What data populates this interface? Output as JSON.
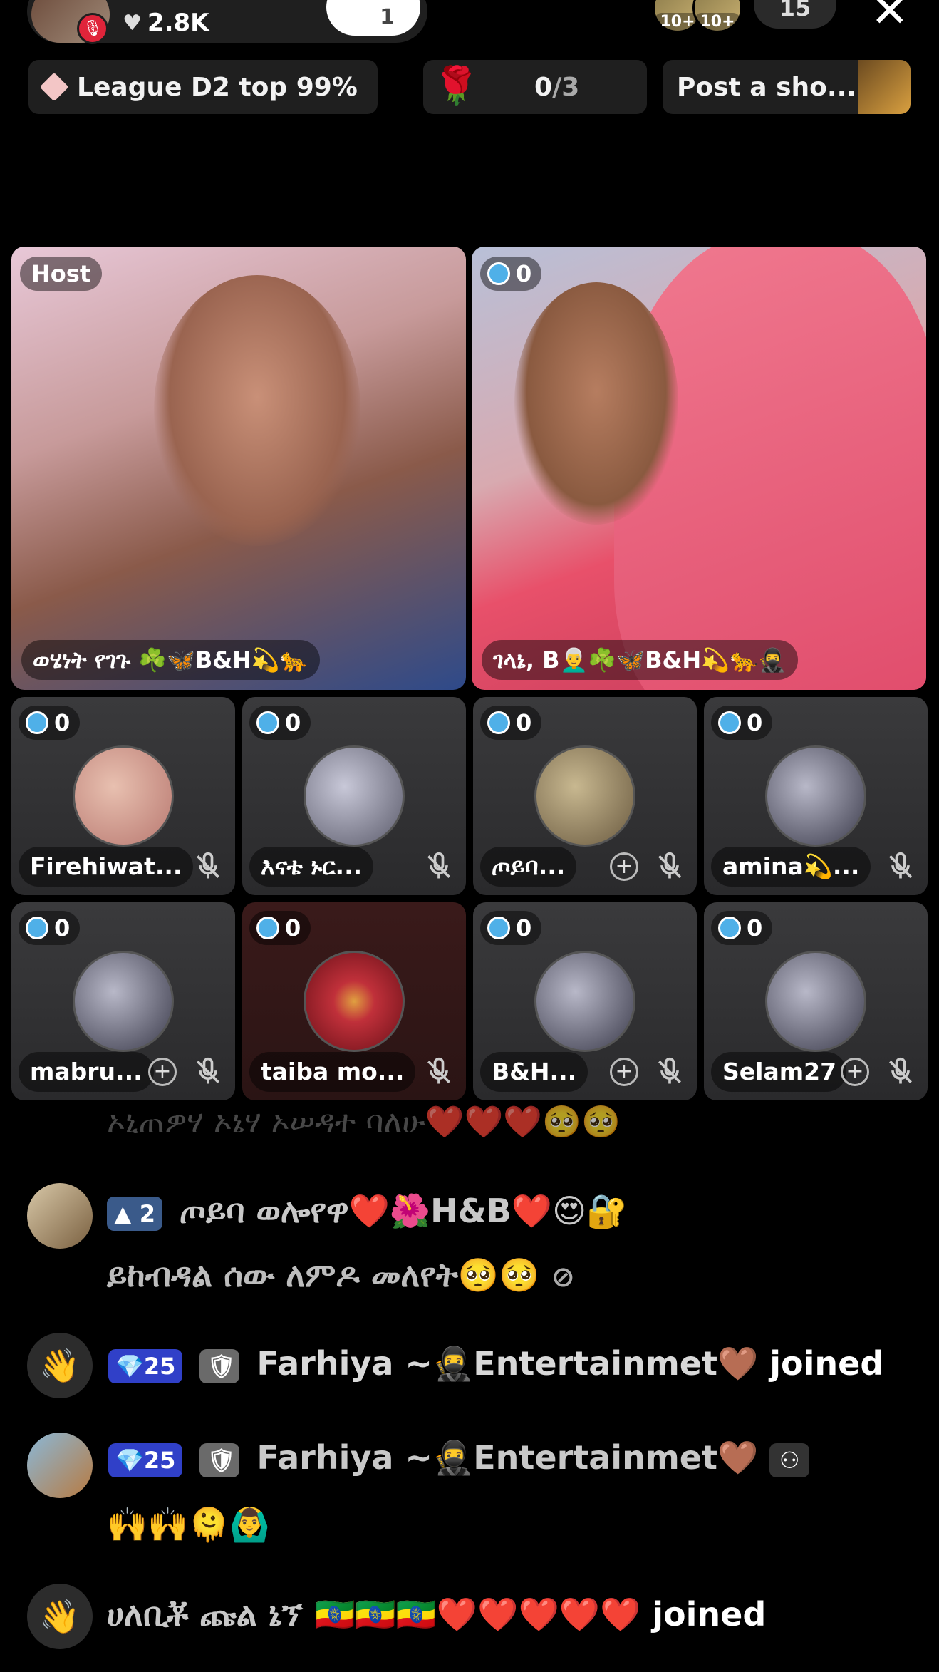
{
  "header": {
    "likes": "2.8K",
    "follow_count": "1",
    "viewer_tags": [
      "10+",
      "10+"
    ],
    "viewer_count": "15",
    "close_icon": "close-icon"
  },
  "chips": {
    "league": "League D2 top 99%",
    "rose_progress": "0",
    "rose_total": "/3",
    "post": "Post a sho..."
  },
  "host_tile": {
    "badge": "Host",
    "name": "ወሄነት የገጉ ☘️🦋B&H💫🐆"
  },
  "guest_tile": {
    "count": "0",
    "name": "ገላኔ, B👨‍🦳☘️🦋B&H💫🐆🥷"
  },
  "seats": [
    {
      "count": "0",
      "name": "Firehiwat...",
      "plus": false,
      "avatar_color": "#b87870"
    },
    {
      "count": "0",
      "name": "እናቴ ኑር...",
      "plus": false,
      "avatar_color": "#7a7a8a"
    },
    {
      "count": "0",
      "name": "ጦይባ...",
      "plus": true,
      "avatar_color": "#8a7a60"
    },
    {
      "count": "0",
      "name": "amina💫...",
      "plus": false,
      "avatar_color": "#5a5a6a"
    },
    {
      "count": "0",
      "name": "mabru...",
      "plus": true,
      "avatar_color": "#5a5a6a"
    },
    {
      "count": "0",
      "name": "taiba mo...",
      "plus": false,
      "avatar_color": "#c0303a"
    },
    {
      "count": "0",
      "name": "B&H...",
      "plus": true,
      "avatar_color": "#5a5a6a"
    },
    {
      "count": "0",
      "name": "Selam27",
      "plus": true,
      "avatar_color": "#5a5a6a"
    }
  ],
  "chat": {
    "faded_line": "ኦኒጠዎሃ ኦኔሃ ኦሠዳተ ባለሁ❤️❤️❤️🥺🥺",
    "msg1": {
      "level": "2",
      "user": "ጦይባ ወሎየዋ❤️🌺H&B❤️😍🔐",
      "text": "ይከብዳል ሰው ለምዶ መለየት🥺🥺"
    },
    "msg2": {
      "level": "25",
      "user": "Farhiya ~🥷Entertainmet🤎",
      "action": "joined"
    },
    "msg3": {
      "level": "25",
      "user": "Farhiya ~🥷Entertainmet🤎",
      "text": "🙌🙌🫠🙆‍♂️"
    },
    "msg4": {
      "user": "ሀለቢቾ ጩል ኔኘ 🇪🇹🇪🇹🇪🇹❤️❤️❤️❤️❤️",
      "action": "joined"
    }
  }
}
